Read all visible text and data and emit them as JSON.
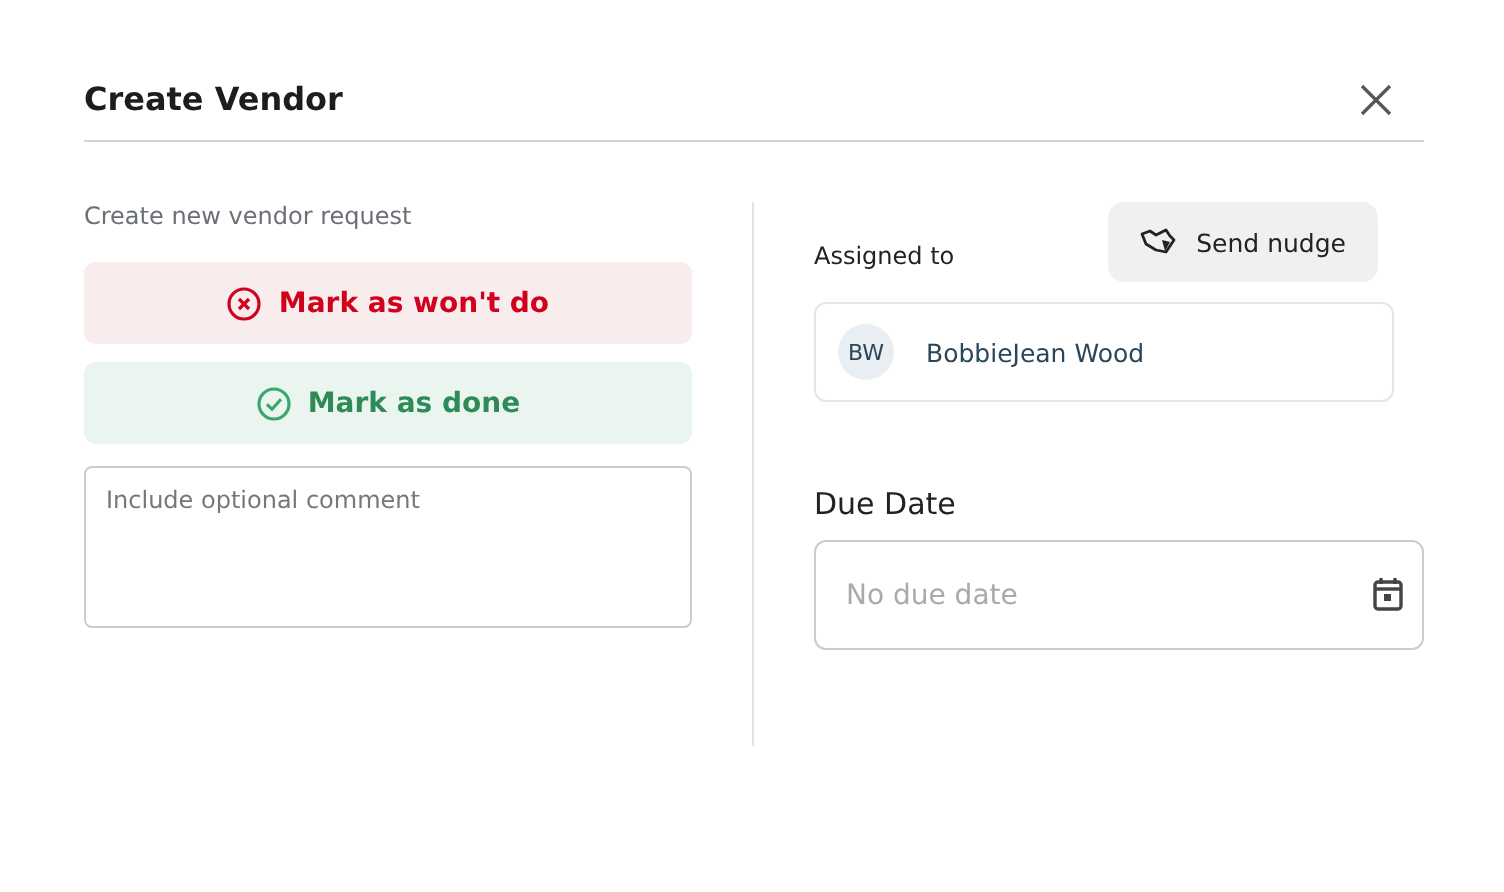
{
  "dialog": {
    "title": "Create Vendor"
  },
  "left": {
    "subtitle": "Create new vendor request",
    "actions": [
      {
        "kind": "reject",
        "label": "Mark as won't do"
      },
      {
        "kind": "done",
        "label": "Mark as done"
      }
    ],
    "comment": {
      "placeholder": "Include optional comment"
    }
  },
  "right": {
    "assigned_label": "Assigned to",
    "nudge_button": "Send nudge",
    "assignee": {
      "initials": "BW",
      "name": "BobbieJean Wood"
    },
    "due_label": "Due Date",
    "due_field": {
      "placeholder": "No due date"
    }
  }
}
